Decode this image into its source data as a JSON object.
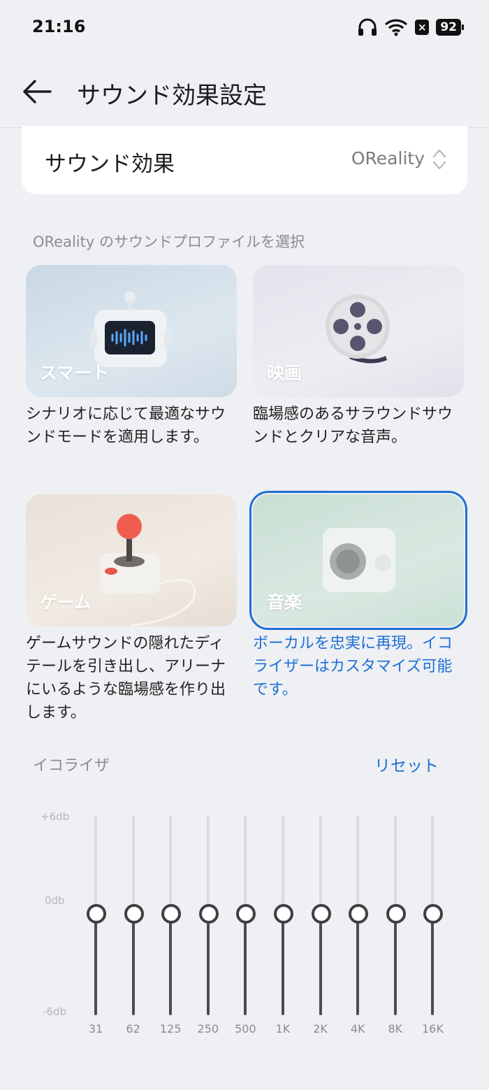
{
  "status_bar": {
    "time": "21:16",
    "battery": "92"
  },
  "header": {
    "title": "サウンド効果設定"
  },
  "sound_effect": {
    "label": "サウンド効果",
    "value": "OReality"
  },
  "profile_section_label": "OReality のサウンドプロファイルを選択",
  "profiles": [
    {
      "title": "スマート",
      "description": "シナリオに応じて最適なサウンドモードを適用します。",
      "selected": false
    },
    {
      "title": "映画",
      "description": "臨場感のあるサラウンドサウンドとクリアな音声。",
      "selected": false
    },
    {
      "title": "ゲーム",
      "description": "ゲームサウンドの隠れたディテールを引き出し、アリーナにいるような臨場感を作り出します。",
      "selected": false
    },
    {
      "title": "音楽",
      "description": "ボーカルを忠実に再現。イコライザーはカスタマイズ可能です。",
      "selected": true
    }
  ],
  "equalizer": {
    "label": "イコライザ",
    "reset_label": "リセット",
    "db_labels": {
      "top": "+6db",
      "mid": "0db",
      "bottom": "-6db"
    },
    "bands": [
      {
        "freq": "31",
        "gain_db": 0
      },
      {
        "freq": "62",
        "gain_db": 0
      },
      {
        "freq": "125",
        "gain_db": 0
      },
      {
        "freq": "250",
        "gain_db": 0
      },
      {
        "freq": "500",
        "gain_db": 0
      },
      {
        "freq": "1K",
        "gain_db": 0
      },
      {
        "freq": "2K",
        "gain_db": 0
      },
      {
        "freq": "4K",
        "gain_db": 0
      },
      {
        "freq": "8K",
        "gain_db": 0
      },
      {
        "freq": "16K",
        "gain_db": 0
      }
    ]
  },
  "colors": {
    "accent": "#1f6fd6",
    "background": "#eef0f3"
  }
}
